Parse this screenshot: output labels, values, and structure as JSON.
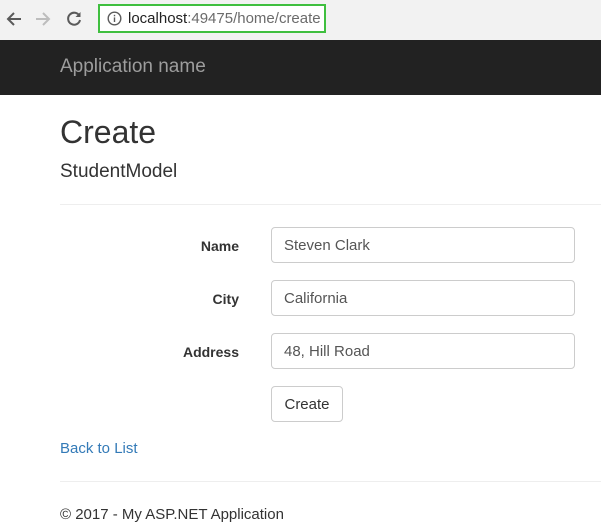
{
  "browser": {
    "url_host": "localhost",
    "url_path": ":49475/home/create",
    "back_icon": "arrow-left-icon",
    "forward_icon": "arrow-right-icon",
    "reload_icon": "reload-icon",
    "info_icon": "info-icon",
    "address_highlight_color": "#3fbf3f"
  },
  "navbar": {
    "brand": "Application name",
    "background": "#222222"
  },
  "page": {
    "title": "Create",
    "subtitle": "StudentModel"
  },
  "form": {
    "fields": [
      {
        "label": "Name",
        "value": "Steven Clark"
      },
      {
        "label": "City",
        "value": "California"
      },
      {
        "label": "Address",
        "value": "48, Hill Road"
      }
    ],
    "submit_label": "Create"
  },
  "links": {
    "back_to_list": "Back to List",
    "link_color": "#337ab7"
  },
  "footer": {
    "text": "© 2017 - My ASP.NET Application"
  }
}
